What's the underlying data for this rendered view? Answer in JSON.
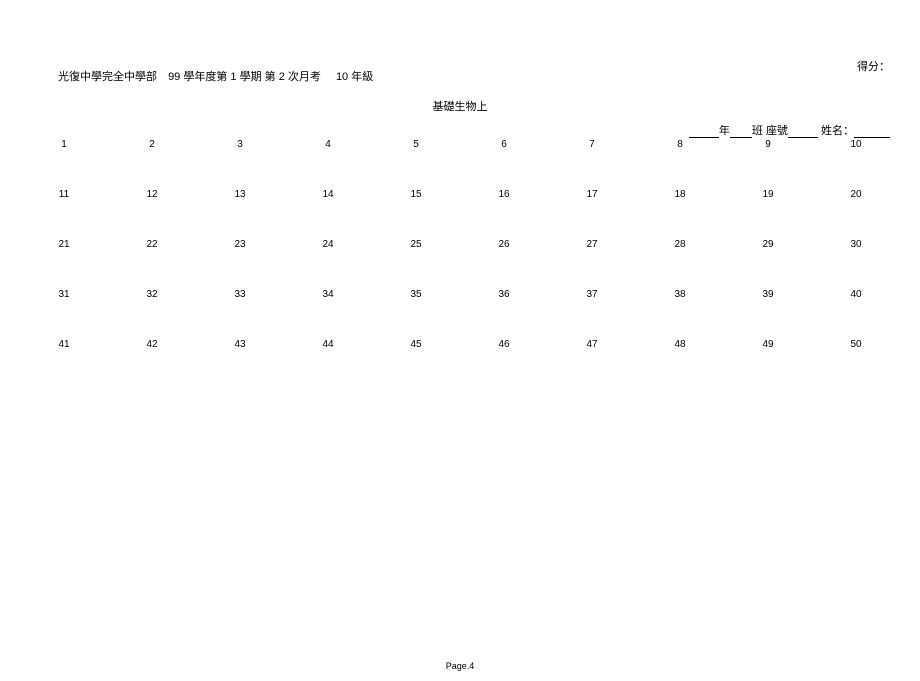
{
  "header": {
    "score_label": "得分：",
    "school": "光復中學完全中學部",
    "year_text": "99 學年度第 1 學期 第 2 次月考",
    "grade_text": "10 年級",
    "subject": "基礎生物上"
  },
  "info": {
    "year_label": "年",
    "class_label": "班",
    "seat_label": "座號",
    "name_label": "姓名："
  },
  "grid": {
    "rows": [
      [
        "1",
        "2",
        "3",
        "4",
        "5",
        "6",
        "7",
        "8",
        "9",
        "10"
      ],
      [
        "11",
        "12",
        "13",
        "14",
        "15",
        "16",
        "17",
        "18",
        "19",
        "20"
      ],
      [
        "21",
        "22",
        "23",
        "24",
        "25",
        "26",
        "27",
        "28",
        "29",
        "30"
      ],
      [
        "31",
        "32",
        "33",
        "34",
        "35",
        "36",
        "37",
        "38",
        "39",
        "40"
      ],
      [
        "41",
        "42",
        "43",
        "44",
        "45",
        "46",
        "47",
        "48",
        "49",
        "50"
      ]
    ]
  },
  "footer": {
    "page": "Page.4"
  }
}
